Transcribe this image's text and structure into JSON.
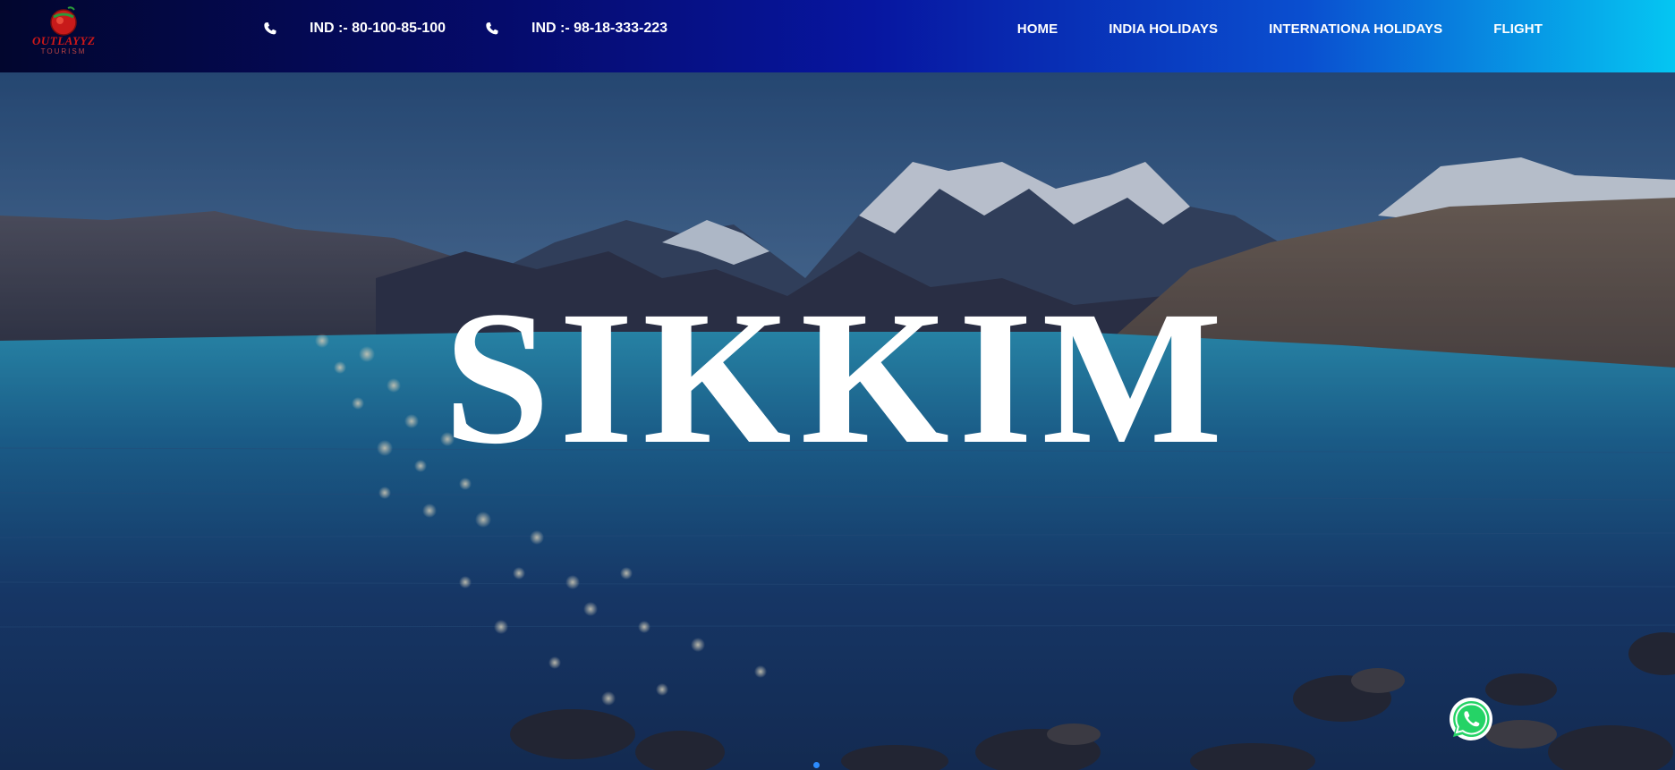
{
  "brand": {
    "logo_text": "OUTLAYYZ",
    "logo_sub": "TOURISM",
    "logo_icon": "globe-logo-icon"
  },
  "contacts": [
    {
      "icon": "phone-icon",
      "label": "IND :- 80-100-85-100"
    },
    {
      "icon": "phone-icon",
      "label": "IND :- 98-18-333-223"
    }
  ],
  "nav": {
    "items": [
      {
        "label": "HOME"
      },
      {
        "label": "INDIA HOLIDAYS"
      },
      {
        "label": "INTERNATIONA HOLIDAYS"
      },
      {
        "label": "FLIGHT"
      }
    ]
  },
  "hero": {
    "title": "SIKKIM",
    "background": "mountain-lake-photo"
  },
  "slider": {
    "active_slide": 1
  },
  "floating": {
    "whatsapp_icon": "whatsapp-icon"
  },
  "colors": {
    "header_start": "#02062e",
    "header_end": "#05c6f2",
    "title": "#ffffff",
    "dot": "#2c8cff",
    "whatsapp": "#25d366"
  }
}
